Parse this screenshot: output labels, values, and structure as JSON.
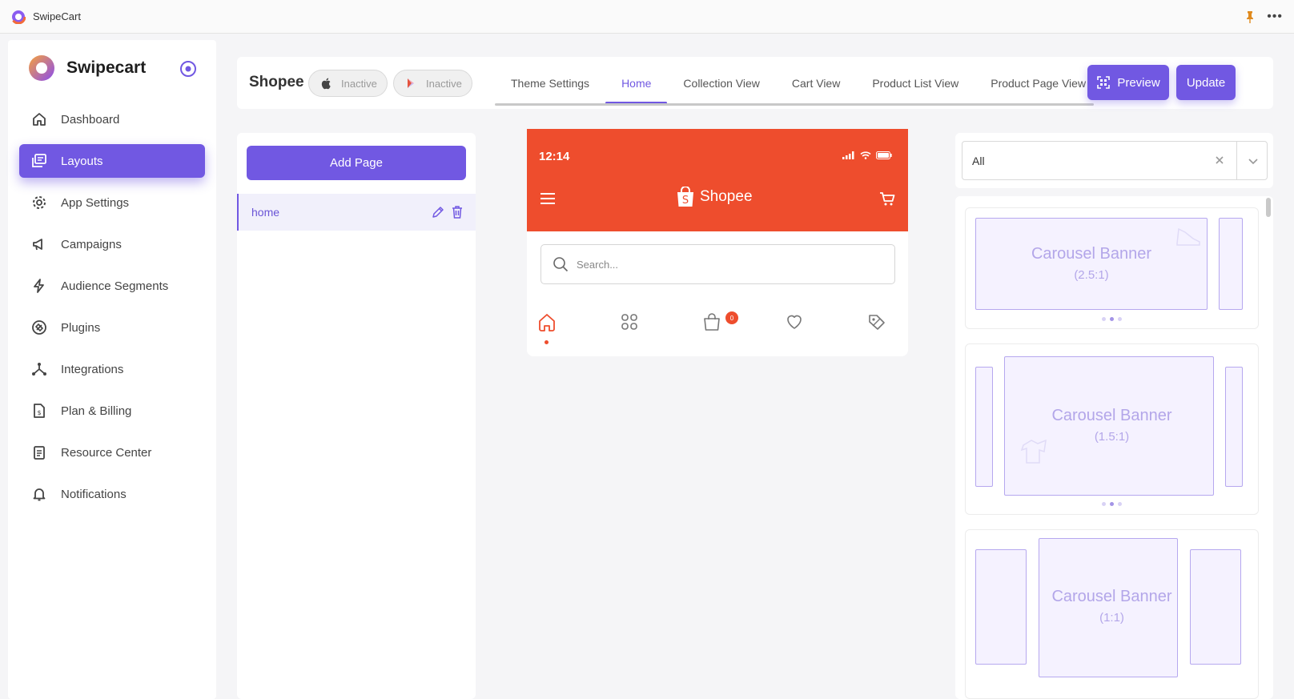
{
  "window": {
    "title": "SwipeCart"
  },
  "sidebar": {
    "brand": "Swipecart",
    "items": [
      {
        "label": "Dashboard",
        "icon": "home-icon",
        "active": false
      },
      {
        "label": "Layouts",
        "icon": "layouts-icon",
        "active": true
      },
      {
        "label": "App Settings",
        "icon": "gear-icon",
        "active": false
      },
      {
        "label": "Campaigns",
        "icon": "megaphone-icon",
        "active": false
      },
      {
        "label": "Audience Segments",
        "icon": "lightning-icon",
        "active": false
      },
      {
        "label": "Plugins",
        "icon": "plug-icon",
        "active": false
      },
      {
        "label": "Integrations",
        "icon": "integrations-icon",
        "active": false
      },
      {
        "label": "Plan & Billing",
        "icon": "billing-icon",
        "active": false
      },
      {
        "label": "Resource Center",
        "icon": "clipboard-icon",
        "active": false
      },
      {
        "label": "Notifications",
        "icon": "bell-icon",
        "active": false
      }
    ]
  },
  "topbar": {
    "store": "Shopee",
    "ios_status": "Inactive",
    "android_status": "Inactive",
    "tabs": [
      "Theme Settings",
      "Home",
      "Collection View",
      "Cart View",
      "Product List View",
      "Product Page View"
    ],
    "active_tab": "Home",
    "preview_label": "Preview",
    "update_label": "Update"
  },
  "pages": {
    "add_label": "Add Page",
    "items": [
      {
        "name": "home"
      }
    ]
  },
  "phone": {
    "time": "12:14",
    "brand": "Shopee",
    "search_placeholder": "Search...",
    "cart_badge": "0"
  },
  "filter": {
    "value": "All"
  },
  "blocks": [
    {
      "title": "Carousel Banner",
      "ratio": "(2.5:1)"
    },
    {
      "title": "Carousel Banner",
      "ratio": "(1.5:1)"
    },
    {
      "title": "Carousel Banner",
      "ratio": "(1:1)"
    }
  ],
  "colors": {
    "accent": "#7158e2",
    "shopee": "#ee4d2d",
    "banner": "#b3a6e9"
  }
}
